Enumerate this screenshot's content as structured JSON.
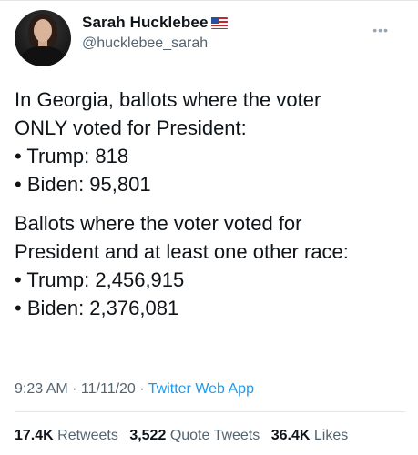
{
  "author": {
    "display_name": "Sarah Hucklebee",
    "handle": "@hucklebee_sarah",
    "flag_icon": "us-flag-icon"
  },
  "more_label": "•••",
  "tweet": {
    "line1": "In Georgia, ballots where the voter",
    "line2": "ONLY voted for President:",
    "bullet1": "• Trump: 818",
    "bullet2": "• Biden: 95,801",
    "line3": "Ballots where the voter voted for",
    "line4": "President and at least one other race:",
    "bullet3": "• Trump: 2,456,915",
    "bullet4": "• Biden: 2,376,081"
  },
  "meta": {
    "time_date": "9:23 AM · 11/11/20 · ",
    "source": "Twitter Web App"
  },
  "stats": {
    "retweets_count": "17.4K",
    "retweets_label": "Retweets",
    "quotes_count": "3,522",
    "quotes_label": "Quote Tweets",
    "likes_count": "36.4K",
    "likes_label": "Likes"
  },
  "colors": {
    "link": "#1d9bf0",
    "secondary_text": "#536471",
    "primary_text": "#0f1419"
  }
}
